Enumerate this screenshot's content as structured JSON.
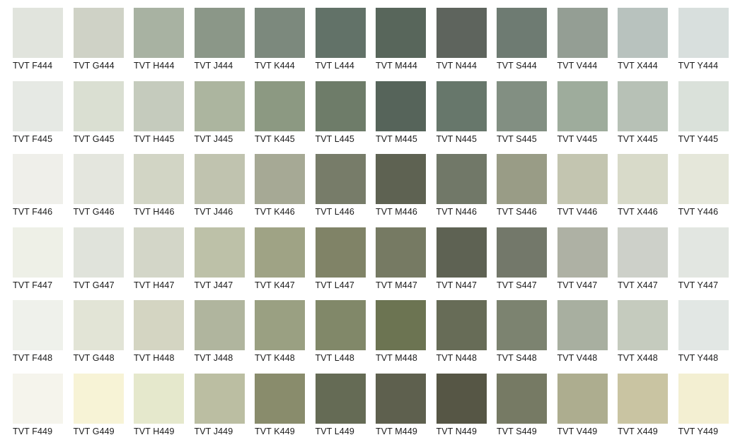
{
  "swatches": [
    {
      "code": "TVT F444",
      "color": "#e1e4dd"
    },
    {
      "code": "TVT G444",
      "color": "#cfd2c6"
    },
    {
      "code": "TVT H444",
      "color": "#a8b2a2"
    },
    {
      "code": "TVT J444",
      "color": "#8b9788"
    },
    {
      "code": "TVT K444",
      "color": "#7c897d"
    },
    {
      "code": "TVT L444",
      "color": "#627268"
    },
    {
      "code": "TVT M444",
      "color": "#58665b"
    },
    {
      "code": "TVT N444",
      "color": "#5e645d"
    },
    {
      "code": "TVT S444",
      "color": "#6e7b72"
    },
    {
      "code": "TVT V444",
      "color": "#949e94"
    },
    {
      "code": "TVT X444",
      "color": "#b8c2be"
    },
    {
      "code": "TVT Y444",
      "color": "#d8dfdd"
    },
    {
      "code": "TVT F445",
      "color": "#e6e9e4"
    },
    {
      "code": "TVT G445",
      "color": "#dadfd2"
    },
    {
      "code": "TVT H445",
      "color": "#c5cbbd"
    },
    {
      "code": "TVT J445",
      "color": "#acb59f"
    },
    {
      "code": "TVT K445",
      "color": "#8c9982"
    },
    {
      "code": "TVT L445",
      "color": "#6e7c69"
    },
    {
      "code": "TVT M445",
      "color": "#56645a"
    },
    {
      "code": "TVT N445",
      "color": "#67776b"
    },
    {
      "code": "TVT S445",
      "color": "#828f82"
    },
    {
      "code": "TVT V445",
      "color": "#9eac9c"
    },
    {
      "code": "TVT X445",
      "color": "#b7c1b6"
    },
    {
      "code": "TVT Y445",
      "color": "#dae1da"
    },
    {
      "code": "TVT F446",
      "color": "#efefea"
    },
    {
      "code": "TVT G446",
      "color": "#e4e6de"
    },
    {
      "code": "TVT H446",
      "color": "#d2d5c5"
    },
    {
      "code": "TVT J446",
      "color": "#c0c3af"
    },
    {
      "code": "TVT K446",
      "color": "#a6a995"
    },
    {
      "code": "TVT L446",
      "color": "#777c69"
    },
    {
      "code": "TVT M446",
      "color": "#5e6252"
    },
    {
      "code": "TVT N446",
      "color": "#717868"
    },
    {
      "code": "TVT S446",
      "color": "#999c86"
    },
    {
      "code": "TVT V446",
      "color": "#c3c5b0"
    },
    {
      "code": "TVT X446",
      "color": "#d8dac9"
    },
    {
      "code": "TVT Y446",
      "color": "#e5e7da"
    },
    {
      "code": "TVT F447",
      "color": "#eef0e7"
    },
    {
      "code": "TVT G447",
      "color": "#e0e3db"
    },
    {
      "code": "TVT H447",
      "color": "#d3d6c8"
    },
    {
      "code": "TVT J447",
      "color": "#bdc1a8"
    },
    {
      "code": "TVT K447",
      "color": "#9fa385"
    },
    {
      "code": "TVT L447",
      "color": "#808367"
    },
    {
      "code": "TVT M447",
      "color": "#767a63"
    },
    {
      "code": "TVT N447",
      "color": "#5e6253"
    },
    {
      "code": "TVT S447",
      "color": "#73786a"
    },
    {
      "code": "TVT V447",
      "color": "#aeb1a4"
    },
    {
      "code": "TVT X447",
      "color": "#cdd0c9"
    },
    {
      "code": "TVT Y447",
      "color": "#e2e6e1"
    },
    {
      "code": "TVT F448",
      "color": "#eff1eb"
    },
    {
      "code": "TVT G448",
      "color": "#e2e4d6"
    },
    {
      "code": "TVT H448",
      "color": "#d4d5c2"
    },
    {
      "code": "TVT J448",
      "color": "#b0b59e"
    },
    {
      "code": "TVT K448",
      "color": "#9aa082"
    },
    {
      "code": "TVT L448",
      "color": "#818869"
    },
    {
      "code": "TVT M448",
      "color": "#6c7452"
    },
    {
      "code": "TVT N448",
      "color": "#676c57"
    },
    {
      "code": "TVT S448",
      "color": "#7c8370"
    },
    {
      "code": "TVT V448",
      "color": "#a8afa0"
    },
    {
      "code": "TVT X448",
      "color": "#c5cbbe"
    },
    {
      "code": "TVT Y448",
      "color": "#e2e7e4"
    },
    {
      "code": "TVT F449",
      "color": "#f5f4ec"
    },
    {
      "code": "TVT G449",
      "color": "#f7f3d6"
    },
    {
      "code": "TVT H449",
      "color": "#e5e8cc"
    },
    {
      "code": "TVT J449",
      "color": "#bbbea2"
    },
    {
      "code": "TVT K449",
      "color": "#898c6c"
    },
    {
      "code": "TVT L449",
      "color": "#656b55"
    },
    {
      "code": "TVT M449",
      "color": "#5e604e"
    },
    {
      "code": "TVT N449",
      "color": "#565645"
    },
    {
      "code": "TVT S449",
      "color": "#767a64"
    },
    {
      "code": "TVT V449",
      "color": "#adad8f"
    },
    {
      "code": "TVT X449",
      "color": "#c9c4a2"
    },
    {
      "code": "TVT Y449",
      "color": "#f3efd2"
    }
  ]
}
